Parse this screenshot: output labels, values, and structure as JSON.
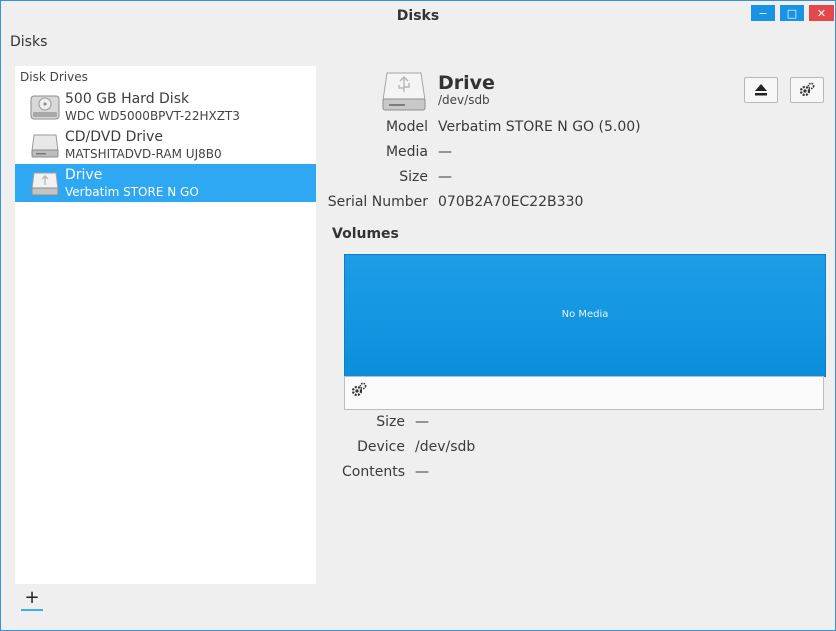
{
  "window": {
    "title": "Disks",
    "min_symbol": "−",
    "max_symbol": "□",
    "close_symbol": "✕"
  },
  "app_menu": "Disks",
  "sidebar": {
    "section_title": "Disk Drives",
    "items": [
      {
        "name": "500 GB Hard Disk",
        "subtitle": "WDC WD5000BPVT-22HXZT3",
        "icon": "hard-disk-icon",
        "selected": false
      },
      {
        "name": "CD/DVD Drive",
        "subtitle": "MATSHITADVD-RAM UJ8B0",
        "icon": "optical-drive-icon",
        "selected": false
      },
      {
        "name": "Drive",
        "subtitle": "Verbatim STORE N GO",
        "icon": "usb-drive-icon",
        "selected": true
      }
    ],
    "add_label": "+"
  },
  "drive": {
    "title": "Drive",
    "path": "/dev/sdb",
    "icon": "usb-drive-icon",
    "properties": [
      {
        "label": "Model",
        "value": "Verbatim STORE N GO (5.00)"
      },
      {
        "label": "Media",
        "value": "—"
      },
      {
        "label": "Size",
        "value": "—"
      },
      {
        "label": "Serial Number",
        "value": "070B2A70EC22B330"
      }
    ],
    "buttons": {
      "eject_icon": "eject-icon",
      "settings_icon": "gear-icon"
    }
  },
  "volumes": {
    "heading": "Volumes",
    "map_label": "No Media",
    "map_color": "#0f94dd",
    "properties": [
      {
        "label": "Size",
        "value": "—"
      },
      {
        "label": "Device",
        "value": "/dev/sdb"
      },
      {
        "label": "Contents",
        "value": "—"
      }
    ]
  }
}
